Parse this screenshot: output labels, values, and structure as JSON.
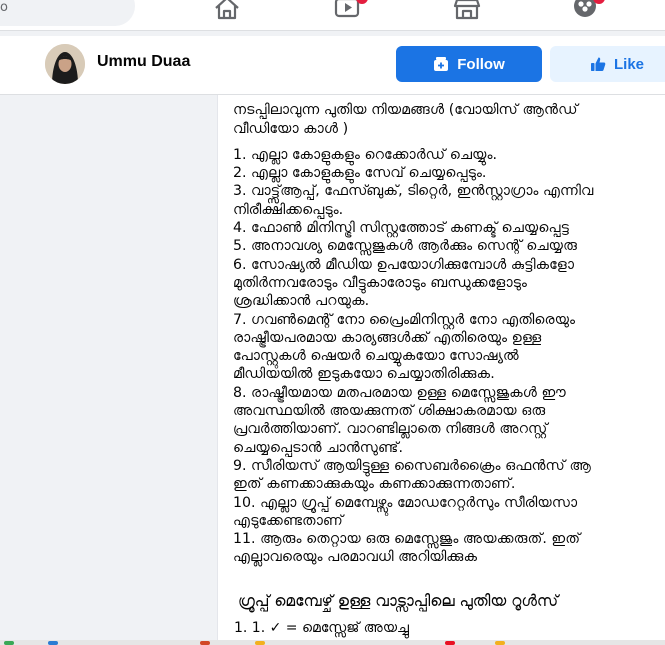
{
  "topbar": {
    "search_fragment": "o",
    "nav_icons": [
      "home-icon",
      "watch-icon",
      "marketplace-icon",
      "groups-icon"
    ],
    "badge_color": "#e41e3f"
  },
  "profile": {
    "name": "Ummu Duaa",
    "follow_label": "Follow",
    "like_label": "Like",
    "accent_color": "#1b74e4"
  },
  "post": {
    "intro_lines": [
      "നടപ്പിലാവുന്ന പുതിയ നിയമങ്ങൾ (വോയിസ് ആൻഡ്",
      "വീഡിയോ കാൾ )"
    ],
    "rules": [
      "1. എല്ലാ കോളുകളും  റെക്കോർഡ് ചെയ്യും.",
      "2. എല്ലാ കോളുകളും സേവ് ചെയ്യപ്പെടും.",
      "3. വാട്ട്സ്ആപ്പ്, ഫേസ്ബുക്, ടിറ്റെർ, ഇൻസ്റ്റാഗ്രാം എന്നിവ",
      "നിരീക്ഷിക്കപ്പെടും.",
      "4. ഫോൺ മിനിസ്ട്രി സിസ്റ്റത്തോട് കണക്ട് ചെയ്യപ്പെട്ട",
      "5. അനാവശ്യ മെസ്സേജുകൾ ആർക്കും സെന്റ് ചെയ്യരു",
      "6. സോഷ്യൽ മീഡിയ ഉപയോഗിക്കുമ്പോൾ കുട്ടികളോ",
      "മുതിർന്നവരോടും വീട്ടുകാരോടും ബന്ധുക്കളോടും",
      "ശ്രദ്ധിക്കാൻ പറയുക.",
      "7. ഗവൺമെന്റ് നോ  പ്രൈംമിനിസ്റ്റർ നോ എതിരെയും",
      "രാഷ്ട്രീയപരമായ കാര്യങ്ങൾക്ക് എതിരെയും ഉള്ള",
      "പോസ്റ്റുകൾ ഷെയർ ചെയ്യുകയോ സോഷ്യൽ",
      "മീഡിയയിൽ ഇടുകയോ ചെയ്യാതിരിക്കുക.",
      "8. രാഷ്ട്രീയമായ മതപരമായ ഉള്ള മെസ്സേജുകൾ ഈ",
      "അവസ്ഥയിൽ അയക്കുന്നത് ശിക്ഷാകരമായ ഒരു",
      "പ്രവർത്തിയാണ്. വാറണ്ടില്ലാതെ നിങ്ങൾ  അറസ്റ്റ്",
      "ചെയ്യപ്പെടാൻ ചാൻസുണ്ട്.",
      "9. സീരിയസ് ആയിട്ടുള്ള സൈബർക്രൈം ഒഫൻസ് ആ",
      "ഇത് കണക്കാക്കുകയും കണക്കാക്കുന്നതാണ്.",
      "10. എല്ലാ ഗ്രൂപ്പ് മെമ്പേഴ്സും മോഡറേറ്റർസും സീരിയസാ",
      "എടുക്കേണ്ടതാണ്",
      "11. ആരും തെറ്റായ ഒരു മെസ്സേജും അയക്കരുത്. ഇത്",
      "എല്ലാവരെയും പരമാവധി അറിയിക്കുക"
    ],
    "heading2": "ഗ്രൂപ്പ് മെമ്പേഴ്ച് ഉള്ള വാട്സാപ്പിലെ പുതിയ റൂൾസ്",
    "subline": "1. 1. ✓ = മെസ്സേജ് അയച്ചു"
  }
}
